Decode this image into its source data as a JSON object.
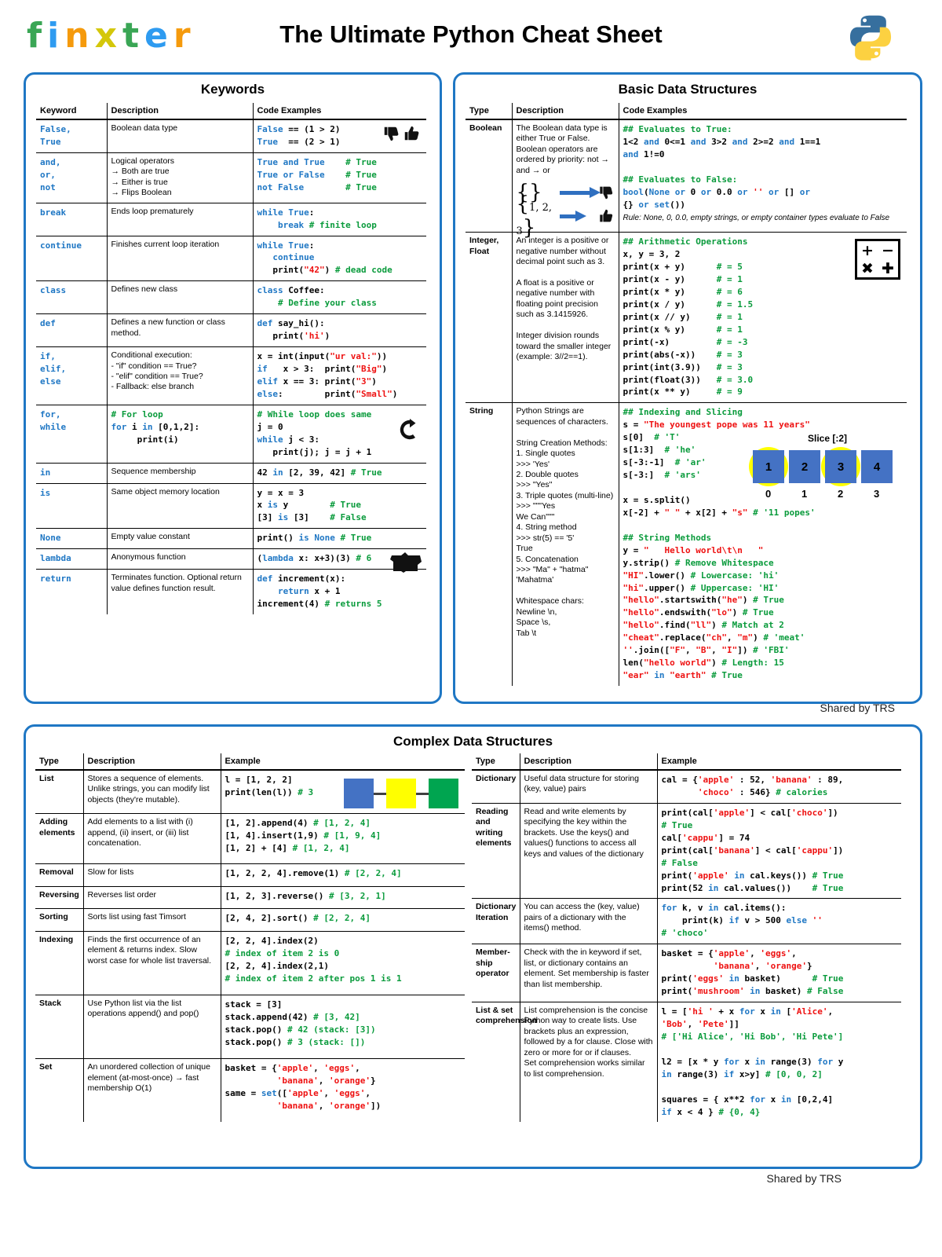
{
  "header": {
    "logo_text": "finxter",
    "logo_letters": [
      {
        "ch": "f",
        "color": "#3aa655"
      },
      {
        "ch": "i",
        "color": "#2e9bf0"
      },
      {
        "ch": "n",
        "color": "#f59a0c"
      },
      {
        "ch": "x",
        "color": "#d4c70a"
      },
      {
        "ch": "t",
        "color": "#3aa655"
      },
      {
        "ch": "e",
        "color": "#2e9bf0"
      },
      {
        "ch": "r",
        "color": "#f59a0c"
      }
    ],
    "title": "The Ultimate Python Cheat Sheet",
    "python_logo": "python-logo"
  },
  "colors": {
    "panel_border": "#1f77c4",
    "code_blue": "#1f77c4",
    "code_green": "#0a9b3c",
    "code_red": "#ee1111",
    "slice_box": "#4472c4",
    "highlight": "#ffff00"
  },
  "footers": {
    "basic": "Shared by TRS",
    "bottom": "Shared by TRS"
  },
  "keywords": {
    "title": "Keywords",
    "columns": [
      "Keyword",
      "Description",
      "Code Examples"
    ],
    "rows": [
      {
        "keyword": "False,\nTrue",
        "description": "Boolean data type",
        "code": "False == (1 > 2)\nTrue  == (2 > 1)",
        "icon": "thumbs-pair"
      },
      {
        "keyword": "and,\nor,\nnot",
        "description": "Logical operators\n→    Both are true\n→    Either is true\n→    Flips Boolean",
        "code": "True and True    # True\nTrue or False    # True\nnot False        # True"
      },
      {
        "keyword": "break",
        "description": "Ends loop prematurely",
        "code": "while True:\n    break # finite loop"
      },
      {
        "keyword": "continue",
        "description": "Finishes current loop iteration",
        "code": "while True:\n   continue\n   print(\"42\") # dead code"
      },
      {
        "keyword": "class",
        "description": "Defines new class",
        "code": "class Coffee:\n    # Define your class"
      },
      {
        "keyword": "def",
        "description": "Defines a new function or class method.",
        "code": "def say_hi():\n   print('hi')"
      },
      {
        "keyword": "if,\nelif,\nelse",
        "description": "Conditional execution:\n- \"if\" condition == True?\n- \"elif\" condition == True?\n- Fallback: else branch",
        "code": "x = int(input(\"ur val:\"))\nif   x > 3:  print(\"Big\")\nelif x == 3: print(\"3\")\nelse:        print(\"Small\")"
      },
      {
        "keyword": "for,\nwhile",
        "description": "# For loop\nfor i in [0,1,2]:\n     print(i)",
        "description_is_code": true,
        "code": "# While loop does same\nj = 0\nwhile j < 3:\n   print(j); j = j + 1",
        "icon": "loop-icon"
      },
      {
        "keyword": "in",
        "description": "Sequence membership",
        "code": "42 in [2, 39, 42] # True"
      },
      {
        "keyword": "is",
        "description": "Same object memory location",
        "code": "y = x = 3\nx is y        # True\n[3] is [3]    # False"
      },
      {
        "keyword": "None",
        "description": "Empty value constant",
        "code": "print() is None # True"
      },
      {
        "keyword": "lambda",
        "description": "Anonymous function",
        "code": "(lambda x: x+3)(3) # 6",
        "icon": "dog-icon"
      },
      {
        "keyword": "return",
        "description": "Terminates function. Optional return value defines function result.",
        "code": "def increment(x):\n    return x + 1\nincrement(4) # returns 5"
      }
    ]
  },
  "basic": {
    "title": "Basic Data Structures",
    "columns": [
      "Type",
      "Description",
      "Code Examples"
    ],
    "rows": [
      {
        "type": "Boolean",
        "description": "The Boolean data type is either True or False. Boolean operators are ordered by priority: not → and → or",
        "figure": "empty-set-false-nonempty-set-true",
        "code": "## Evaluates to True:\n1<2 and 0<=1 and 3>2 and 2>=2 and 1==1\nand 1!=0\n\n## Evaluates to False:\nbool(None or 0 or 0.0 or '' or [] or\n{} or set())",
        "note": "Rule: None, 0, 0.0, empty strings, or empty container types evaluate to False"
      },
      {
        "type": "Integer,\nFloat",
        "description": "An integer is a positive or negative number without decimal point such as 3.\n\nA float is a positive or negative number with floating point precision such as 3.1415926.\n\nInteger division rounds toward the smaller integer (example: 3//2==1).",
        "code": "## Arithmetic Operations\nx, y = 3, 2\nprint(x + y)      # = 5\nprint(x - y)      # = 1\nprint(x * y)      # = 6\nprint(x / y)      # = 1.5\nprint(x // y)     # = 1\nprint(x % y)      # = 1\nprint(-x)         # = -3\nprint(abs(-x))    # = 3\nprint(int(3.9))   # = 3\nprint(float(3))   # = 3.0\nprint(x ** y)     # = 9",
        "icon": "calculator-icon"
      },
      {
        "type": "String",
        "description": "Python Strings are sequences of characters.\n\nString Creation Methods:\n1. Single quotes\n>>> 'Yes'\n2. Double quotes\n>>> \"Yes\"\n3. Triple quotes (multi-line)\n>>> \"\"\"Yes\n       We Can\"\"\"\n4. String method\n>>> str(5) == '5'\nTrue\n5. Concatenation\n>>> \"Ma\" + \"hatma\"\n'Mahatma'\n\nWhitespace chars:\nNewline \\n,\nSpace \\s,\nTab \\t",
        "code": "## Indexing and Slicing\ns = \"The youngest pope was 11 years\"\ns[0]  # 'T'\ns[1:3]  # 'he'\ns[-3:-1]  # 'ar'\ns[-3:]  # 'ars'\n\nx = s.split()\nx[-2] + \" \" + x[2] + \"s\" # '11 popes'\n\n## String Methods\ny = \"   Hello world\\t\\n   \"\ny.strip() # Remove Whitespace\n\"HI\".lower() # Lowercase: 'hi'\n\"hi\".upper() # Uppercase: 'HI'\n\"hello\".startswith(\"he\") # True\n\"hello\".endswith(\"lo\") # True\n\"hello\".find(\"ll\") # Match at 2\n\"cheat\".replace(\"ch\", \"m\") # 'meat'\n''.join([\"F\", \"B\", \"I\"]) # 'FBI'\nlen(\"hello world\") # Length: 15\n\"ear\" in \"earth\" # True",
        "figure": "slice-diagram"
      }
    ],
    "slice_figure": {
      "label": "Slice [:2]",
      "values": [
        "1",
        "2",
        "3",
        "4"
      ],
      "indices": [
        "0",
        "1",
        "2",
        "3"
      ],
      "highlighted": [
        0,
        2
      ]
    },
    "calculator_keys": [
      "+",
      "−",
      "✖",
      "✚"
    ]
  },
  "complex": {
    "title": "Complex Data Structures",
    "columns": [
      "Type",
      "Description",
      "Example"
    ],
    "left_rows": [
      {
        "type": "List",
        "description": "Stores a sequence of elements. Unlike strings, you can modify list objects (they're mutable).",
        "code": "l = [1, 2, 2]\nprint(len(l)) # 3",
        "figure": "list-squares"
      },
      {
        "type": "Adding elements",
        "description": "Add elements to a list with (i) append, (ii) insert, or (iii) list concatenation.",
        "code": "[1, 2].append(4) # [1, 2, 4]\n[1, 4].insert(1,9) # [1, 9, 4]\n[1, 2] + [4] # [1, 2, 4]"
      },
      {
        "type": "Removal",
        "description": "Slow for lists",
        "code": "[1, 2, 2, 4].remove(1) # [2, 2, 4]"
      },
      {
        "type": "Reversing",
        "description": "Reverses list order",
        "code": "[1, 2, 3].reverse() # [3, 2, 1]"
      },
      {
        "type": "Sorting",
        "description": "Sorts list using fast Timsort",
        "code": "[2, 4, 2].sort() # [2, 2, 4]"
      },
      {
        "type": "Indexing",
        "description": "Finds the first occurrence of an element & returns index. Slow worst case for whole list traversal.",
        "code": "[2, 2, 4].index(2)\n# index of item 2 is 0\n[2, 2, 4].index(2,1)\n# index of item 2 after pos 1 is 1"
      },
      {
        "type": "Stack",
        "description": "Use Python list via the list operations append() and pop()",
        "code": "stack = [3]\nstack.append(42) # [3, 42]\nstack.pop() # 42 (stack: [3])\nstack.pop() # 3 (stack: [])"
      },
      {
        "type": "Set",
        "description": "An unordered collection of unique element (at-most-once) → fast membership O(1)",
        "code": "basket = {'apple', 'eggs',\n          'banana', 'orange'}\nsame = set(['apple', 'eggs',\n          'banana', 'orange'])"
      }
    ],
    "right_rows": [
      {
        "type": "Dictionary",
        "description": "Useful data structure for storing (key, value) pairs",
        "code": "cal = {'apple' : 52, 'banana' : 89,\n       'choco' : 546} # calories"
      },
      {
        "type": "Reading and writing elements",
        "description": "Read and write elements by specifying the key within the brackets. Use the keys() and values() functions to access all keys and values of the dictionary",
        "code": "print(cal['apple'] < cal['choco'])\n# True\ncal['cappu'] = 74\nprint(cal['banana'] < cal['cappu'])\n# False\nprint('apple' in cal.keys()) # True\nprint(52 in cal.values())    # True"
      },
      {
        "type": "Dictionary Iteration",
        "description": "You can access the (key, value) pairs of a dictionary with the items() method.",
        "code": "for k, v in cal.items():\n    print(k) if v > 500 else ''\n# 'choco'"
      },
      {
        "type": "Member-ship operator",
        "description": "Check with the in keyword if set, list, or dictionary contains an element. Set membership is faster than list membership.",
        "code": "basket = {'apple', 'eggs',\n          'banana', 'orange'}\nprint('eggs' in basket)      # True\nprint('mushroom' in basket) # False"
      },
      {
        "type": "List & set comprehension",
        "description": "List comprehension is the concise Python way to create lists. Use brackets plus an expression, followed by a for clause. Close with zero or more for or if clauses.\nSet comprehension works similar to list comprehension.",
        "code": "l = ['hi ' + x for x in ['Alice',\n'Bob', 'Pete']]\n# ['Hi Alice', 'Hi Bob', 'Hi Pete']\n\nl2 = [x * y for x in range(3) for y\nin range(3) if x>y] # [0, 0, 2]\n\nsquares = { x**2 for x in [0,2,4]\nif x < 4 } # {0, 4}"
      }
    ],
    "list_figure_colors": [
      "#4472c4",
      "#ffff00",
      "#00a550"
    ]
  }
}
